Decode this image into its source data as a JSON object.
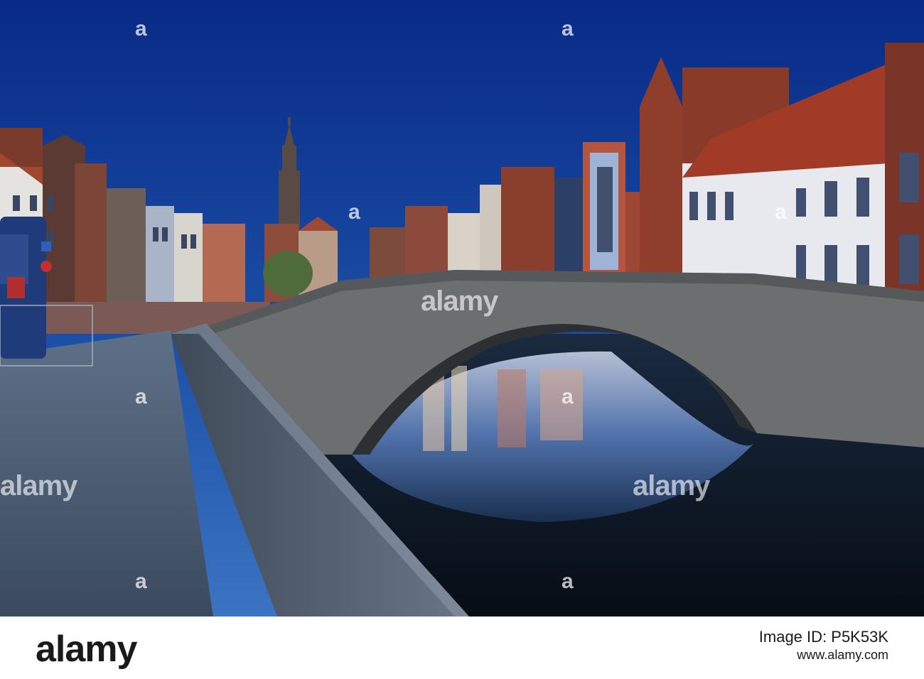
{
  "photo": {
    "alt_subject": "canal-bridge-at-dusk"
  },
  "watermarks": {
    "center_text": "alamy",
    "left_text": "alamy",
    "right_text": "alamy",
    "corner_mark": "a"
  },
  "footer": {
    "logo": "alamy",
    "image_id_label": "Image ID:",
    "image_id": "P5K53K",
    "url": "www.alamy.com"
  },
  "colors": {
    "sky_top": "#0a2f8e",
    "sky_bottom": "#2a63b8",
    "water": "#0c1724",
    "stone": "#6b6f70",
    "brick": "#8a3f2c"
  }
}
